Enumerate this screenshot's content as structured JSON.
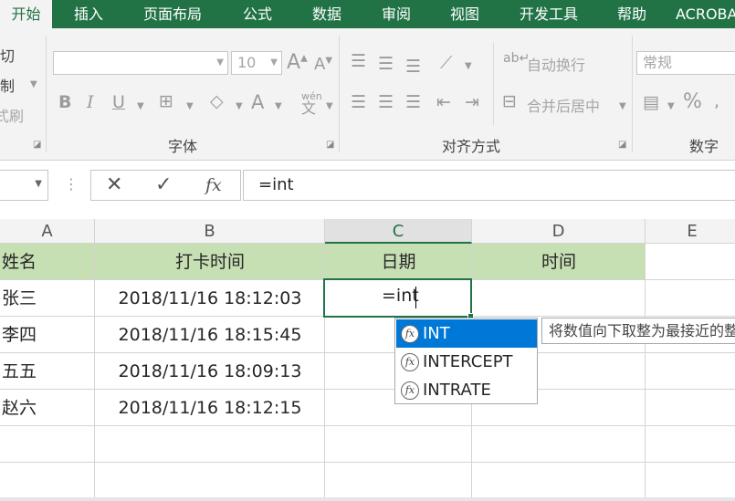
{
  "tabs": [
    "开始",
    "插入",
    "页面布局",
    "公式",
    "数据",
    "审阅",
    "视图",
    "开发工具",
    "帮助",
    "ACROBAT"
  ],
  "clipboard": {
    "cut": "剪切",
    "copy": "复制",
    "format_painter": "格式刷"
  },
  "font": {
    "name_value": "",
    "size_value": "10",
    "bold": "B",
    "italic": "I",
    "underline": "U",
    "increase": "A",
    "decrease": "A",
    "font_color": "A",
    "phonetic_top": "wén",
    "phonetic_bottom": "文",
    "group_label": "字体"
  },
  "alignment": {
    "wrap_text": "自动换行",
    "merge_center": "合并后居中",
    "group_label": "对齐方式"
  },
  "number": {
    "format_value": "常规",
    "percent": "%",
    "group_label": "数字"
  },
  "formula_bar": {
    "cancel": "✕",
    "enter": "✓",
    "fx": "fx",
    "content": "=int"
  },
  "columns": [
    "A",
    "B",
    "C",
    "D",
    "E"
  ],
  "table": {
    "headers": [
      "姓名",
      "打卡时间",
      "日期",
      "时间"
    ],
    "rows": [
      [
        "张三",
        "2018/11/16 18:12:03"
      ],
      [
        "李四",
        "2018/11/16 18:15:45"
      ],
      [
        "五五",
        "2018/11/16 18:09:13"
      ],
      [
        "赵六",
        "2018/11/16 18:12:15"
      ]
    ]
  },
  "editing_cell": {
    "text": "=int"
  },
  "autocomplete": {
    "items": [
      "INT",
      "INTERCEPT",
      "INTRATE"
    ],
    "selected_index": 0,
    "fx_glyph": "fx"
  },
  "tooltip": "将数值向下取整为最接近的整数",
  "colors": {
    "brand": "#217346",
    "header_fill": "#c6e0b4",
    "selection": "#0078d7"
  }
}
